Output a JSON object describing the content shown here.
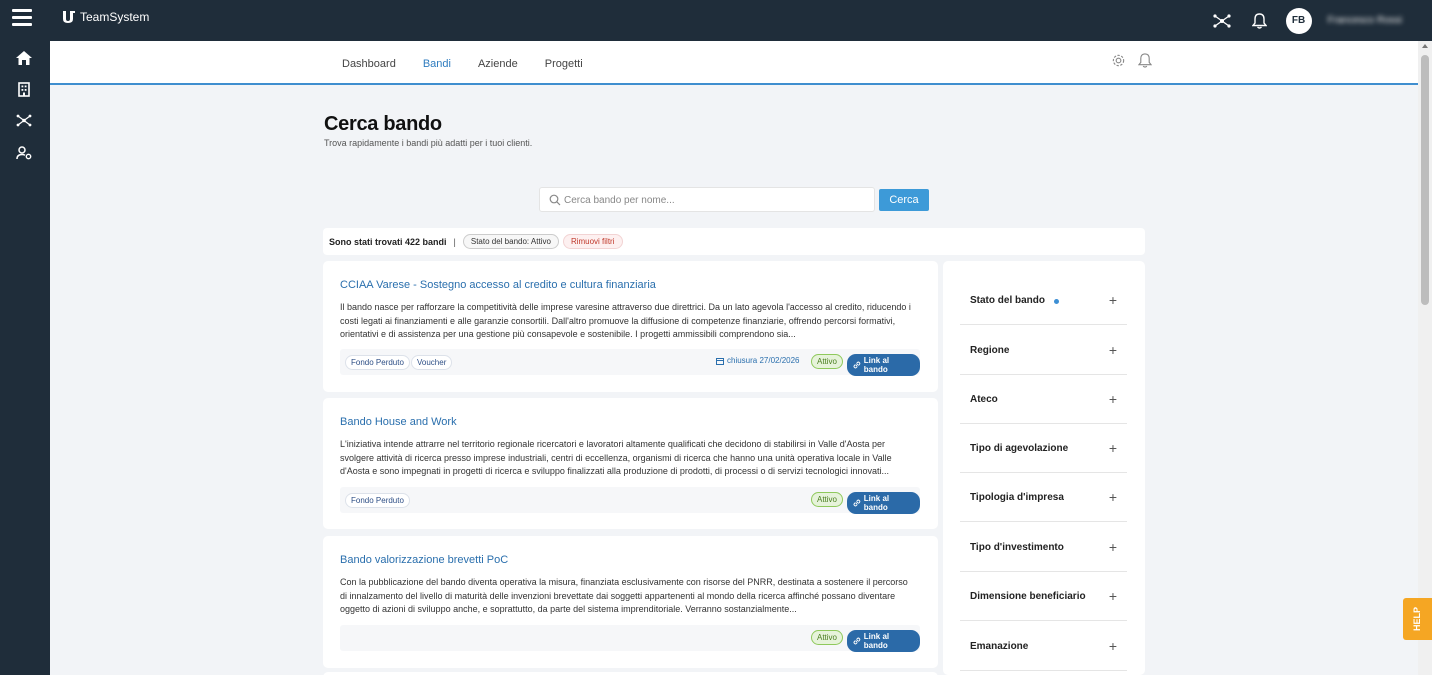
{
  "app": {
    "brand": "TeamSystem",
    "user_initials": "FB",
    "user_name": "Francesco Rossi"
  },
  "nav": {
    "tabs": [
      "Dashboard",
      "Bandi",
      "Aziende",
      "Progetti"
    ],
    "active": "Bandi"
  },
  "header": {
    "title": "Cerca bando",
    "subtitle": "Trova rapidamente i bandi più adatti per i tuoi clienti."
  },
  "search": {
    "placeholder": "Cerca bando per nome...",
    "button": "Cerca"
  },
  "results": {
    "count_text": "Sono stati trovati 422 bandi",
    "separator": "|",
    "filter_chip": "Stato del bando: Attivo",
    "remove_filters": "Rimuovi filtri"
  },
  "cards": [
    {
      "title": "CCIAA Varese - Sostegno accesso al credito e cultura finanziaria",
      "description": "Il bando nasce per rafforzare la competitività delle imprese varesine attraverso due direttrici. Da un lato agevola l'accesso al credito, riducendo i costi legati ai finanziamenti e alle garanzie consortili. Dall'altro promuove la diffusione di competenze finanziarie, offrendo percorsi formativi, orientativi e di assistenza per una gestione più consapevole e sostenibile. I progetti ammissibili comprendono sia...",
      "tags": [
        "Fondo Perduto",
        "Voucher"
      ],
      "closing": "chiusura 27/02/2026",
      "status": "Attivo",
      "link": "Link al bando"
    },
    {
      "title": "Bando House and Work",
      "description": "L'iniziativa intende attrarre nel territorio regionale ricercatori e lavoratori altamente qualificati che decidono di stabilirsi in Valle d'Aosta per svolgere attività di ricerca presso imprese industriali, centri di eccellenza, organismi di ricerca che hanno una unità operativa locale in Valle d'Aosta e sono impegnati in progetti di ricerca e sviluppo finalizzati alla produzione di prodotti, di processi o di servizi tecnologici innovati...",
      "tags": [
        "Fondo Perduto"
      ],
      "closing": "",
      "status": "Attivo",
      "link": "Link al bando"
    },
    {
      "title": "Bando valorizzazione brevetti PoC",
      "description": "Con la pubblicazione del bando diventa operativa la misura, finanziata esclusivamente con risorse del PNRR, destinata a sostenere il percorso di innalzamento del livello di maturità delle invenzioni brevettate dai soggetti appartenenti al mondo della ricerca affinché possano diventare oggetto di azioni di sviluppo anche, e soprattutto, da parte del sistema imprenditoriale. Verranno sostanzialmente...",
      "tags": [],
      "closing": "",
      "status": "Attivo",
      "link": "Link al bando"
    }
  ],
  "filters": [
    {
      "label": "Stato del bando",
      "active": true
    },
    {
      "label": "Regione",
      "active": false
    },
    {
      "label": "Ateco",
      "active": false
    },
    {
      "label": "Tipo di agevolazione",
      "active": false
    },
    {
      "label": "Tipologia d'impresa",
      "active": false
    },
    {
      "label": "Tipo d'investimento",
      "active": false
    },
    {
      "label": "Dimensione beneficiario",
      "active": false
    },
    {
      "label": "Emanazione",
      "active": false
    }
  ],
  "filter_plus": "+",
  "help": {
    "label": "HELP"
  },
  "colors": {
    "topbar": "#1f2d3a",
    "accent": "#3d9ad8",
    "link": "#2a6fad",
    "status": "#8fc95c",
    "help": "#f5a623"
  },
  "icons": [
    "menu-icon",
    "teamsystem-logo",
    "network-icon",
    "bell-icon",
    "home-icon",
    "building-icon",
    "hierarchy-icon",
    "user-settings-icon",
    "gear-icon",
    "search-icon",
    "calendar-icon",
    "link-icon"
  ]
}
